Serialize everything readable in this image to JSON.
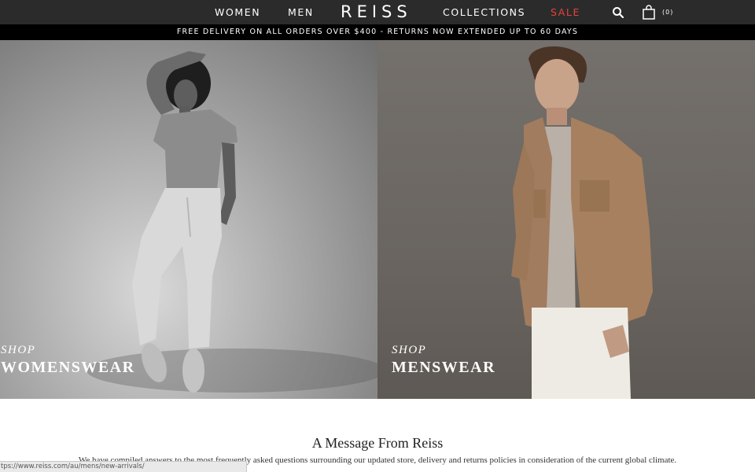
{
  "nav": {
    "women_label": "WOMEN",
    "men_label": "MEN",
    "logo_text": "REISS",
    "collections_label": "COLLECTIONS",
    "sale_label": "SALE",
    "bag_count": "(0)",
    "search_icon": "search-icon",
    "bag_icon": "shopping-bag-icon"
  },
  "promo": {
    "text": "FREE DELIVERY ON ALL ORDERS OVER $400 - RETURNS NOW EXTENDED UP TO 60 DAYS"
  },
  "hero": {
    "women": {
      "kicker": "SHOP",
      "title": "WOMENSWEAR"
    },
    "men": {
      "kicker": "SHOP",
      "title": "MENSWEAR"
    }
  },
  "message": {
    "title": "A Message From Reiss",
    "body": "We have compiled answers to the most frequently asked questions surrounding our updated store, delivery and returns policies in consideration of the current global climate."
  },
  "status": {
    "url": "tps://www.reiss.com/au/mens/new-arrivals/"
  },
  "colors": {
    "nav_bg": "#2b2b2b",
    "promo_bg": "#000000",
    "sale": "#e8413c"
  }
}
